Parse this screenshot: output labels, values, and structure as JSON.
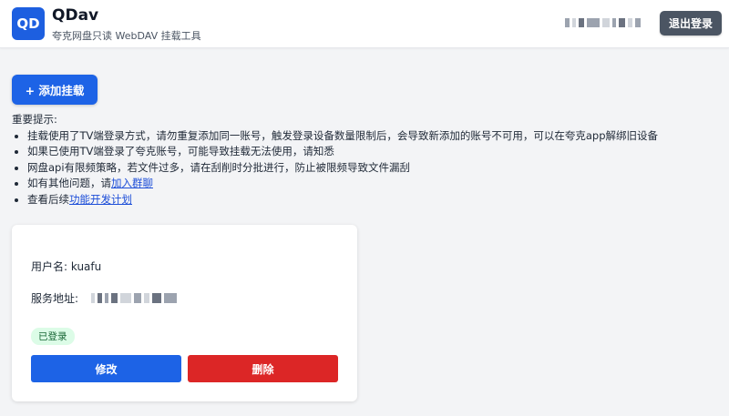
{
  "header": {
    "logo_text": "QD",
    "title": "QDav",
    "subtitle": "夸克网盘只读 WebDAV 挂载工具",
    "logout_label": "退出登录"
  },
  "actions": {
    "add_mount_label": "+ 添加挂载"
  },
  "notice": {
    "heading": "重要提示:",
    "items": [
      "挂载使用了TV端登录方式，请勿重复添加同一账号，触发登录设备数量限制后，会导致新添加的账号不可用，可以在夸克app解绑旧设备",
      "如果已使用TV端登录了夸克账号，可能导致挂载无法使用，请知悉",
      "网盘api有限频策略，若文件过多，请在刮削时分批进行，防止被限频导致文件漏刮"
    ],
    "item4_prefix": "如有其他问题，请",
    "item4_link": "加入群聊",
    "item5_prefix": "查看后续",
    "item5_link": "功能开发计划"
  },
  "mount_card": {
    "username_label": "用户名: ",
    "username_value": "kuafu",
    "address_label": "服务地址: ",
    "status_badge": "已登录",
    "edit_label": "修改",
    "delete_label": "删除"
  },
  "colors": {
    "primary": "#1d63e6",
    "danger": "#dc2626",
    "success_bg": "#dcfce7",
    "success_text": "#166534",
    "logout_bg": "#4b5563"
  }
}
